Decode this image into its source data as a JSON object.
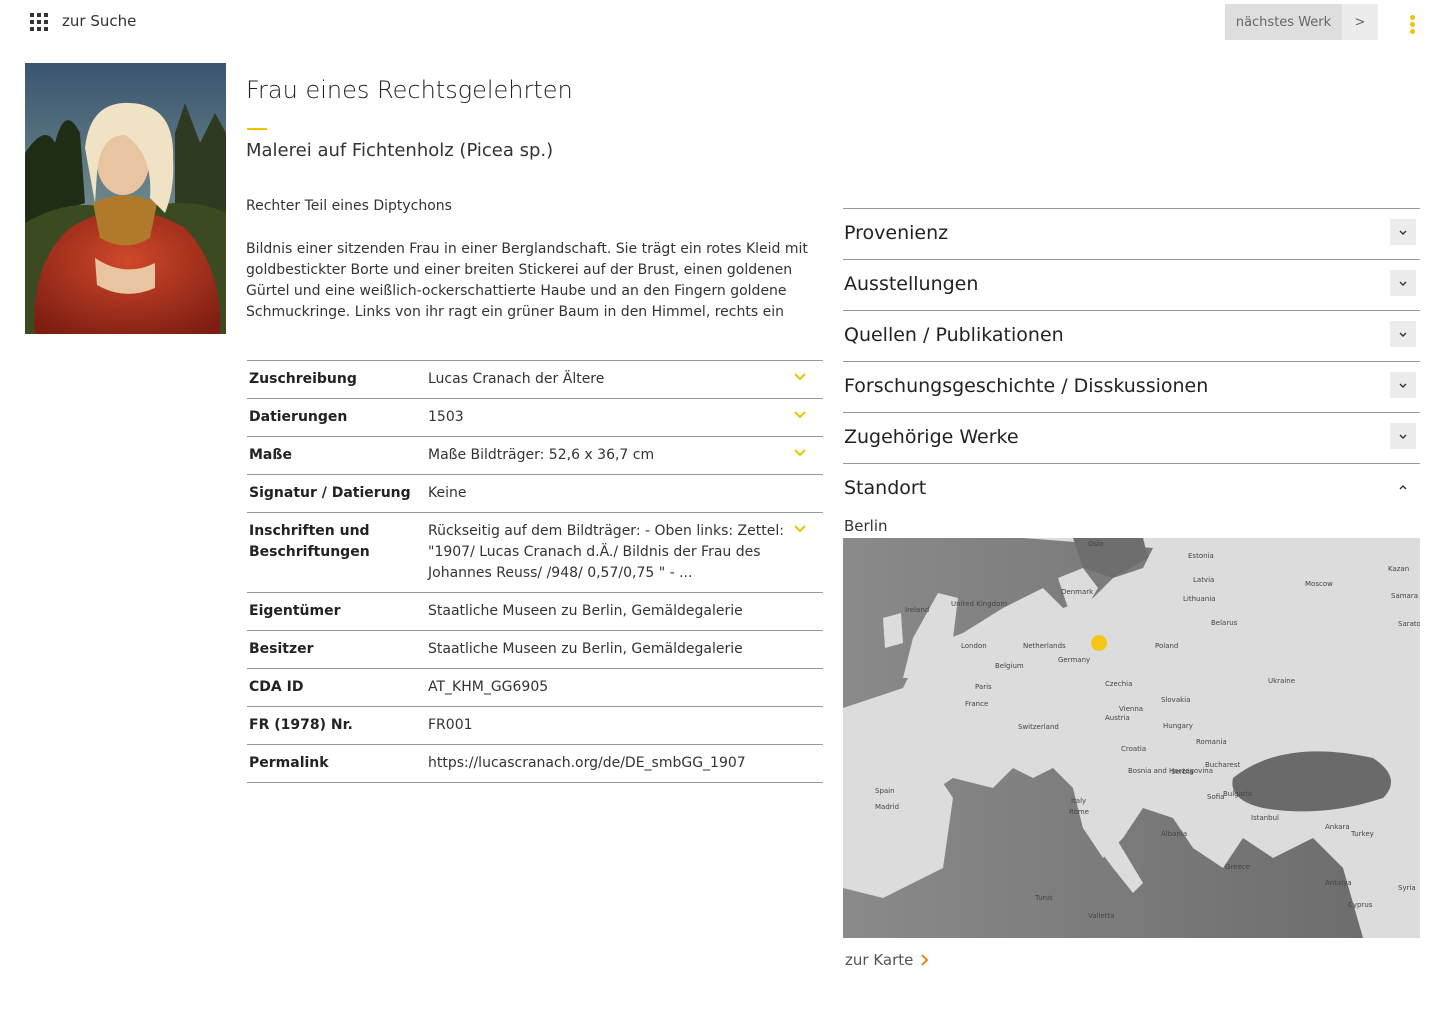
{
  "header": {
    "back_label": "zur Suche",
    "next_label": "nächstes Werk",
    "next_arrow": ">"
  },
  "colors": {
    "accent": "#f1c400",
    "rule": "#999999"
  },
  "artwork": {
    "title": "Frau eines Rechtsgelehrten",
    "subtitle": "Malerei auf Fichtenholz (Picea sp.)",
    "part_note": "Rechter Teil eines Diptychons",
    "description": "Bildnis einer sitzenden Frau in einer Berglandschaft. Sie trägt ein rotes Kleid mit goldbestickter Borte und einer breiten Stickerei auf der Brust, einen goldenen Gürtel und eine weißlich-ockerschattierte Haube und an den Fingern goldene Schmuckringe. Links von ihr ragt ein grüner Baum in den Himmel, rechts ein"
  },
  "facts": [
    {
      "label": "Zuschreibung",
      "value": "Lucas Cranach der Ältere",
      "expandable": true
    },
    {
      "label": "Datierungen",
      "value": "1503",
      "expandable": true
    },
    {
      "label": "Maße",
      "value": "Maße Bildträger: 52,6 x 36,7 cm",
      "expandable": true
    },
    {
      "label": "Signatur / Datierung",
      "value": "Keine",
      "expandable": false
    },
    {
      "label": "Inschriften und Beschriftungen",
      "value": "Rückseitig auf dem Bildträger: - Oben links: Zettel: \"1907/ Lucas Cranach d.Ä./ Bildnis der Frau des Johannes Reuss/ /948/ 0,57/0,75 \" - ...",
      "expandable": true
    },
    {
      "label": "Eigentümer",
      "value": "Staatliche Museen zu Berlin, Gemäldegalerie",
      "expandable": false
    },
    {
      "label": "Besitzer",
      "value": "Staatliche Museen zu Berlin, Gemäldegalerie",
      "expandable": false
    },
    {
      "label": "CDA ID",
      "value": "AT_KHM_GG6905",
      "expandable": false
    },
    {
      "label": "FR (1978) Nr.",
      "value": "FR001",
      "expandable": false
    },
    {
      "label": "Permalink",
      "value": "https://lucascranach.org/de/DE_smbGG_1907",
      "expandable": false
    }
  ],
  "sections": [
    {
      "title": "Provenienz",
      "open": false
    },
    {
      "title": "Ausstellungen",
      "open": false
    },
    {
      "title": "Quellen / Publikationen",
      "open": false
    },
    {
      "title": "Forschungsgeschichte / Disskussionen",
      "open": false
    },
    {
      "title": "Zugehörige Werke",
      "open": false
    },
    {
      "title": "Standort",
      "open": true
    }
  ],
  "location": {
    "city": "Berlin",
    "map_link_label": "zur Karte",
    "map_labels": [
      "Oslo",
      "Estonia",
      "Latvia",
      "Moscow",
      "Kazan",
      "Denmark",
      "Lithuania",
      "Ireland",
      "United Kingdom",
      "London",
      "Netherlands",
      "Belarus",
      "Samara",
      "Saratov",
      "Poland",
      "Germany",
      "Belgium",
      "Ukraine",
      "Paris",
      "Czechia",
      "Slovakia",
      "France",
      "Austria",
      "Vienna",
      "Hungary",
      "Switzerland",
      "Romania",
      "Croatia",
      "Bucharest",
      "Bosnia and Herzegovina",
      "Serbia",
      "Spain",
      "Madrid",
      "Sofia",
      "Bulgaria",
      "Italy",
      "Rome",
      "Istanbul",
      "Ankara",
      "Turkey",
      "Albania",
      "Greece",
      "Antalya",
      "Syria",
      "Cyprus",
      "Valletta",
      "Tunis"
    ]
  }
}
